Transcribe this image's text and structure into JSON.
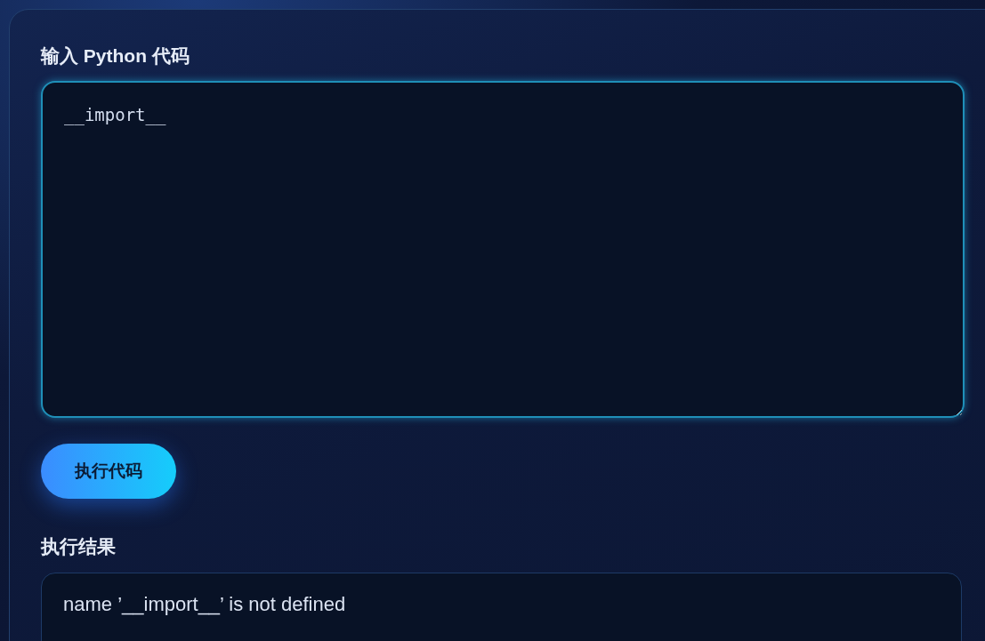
{
  "code_input": {
    "label": "输入 Python 代码",
    "value": "__import__"
  },
  "run_button": {
    "label": "执行代码"
  },
  "result": {
    "label": "执行结果",
    "output": "name ’__import__’ is not defined"
  }
}
